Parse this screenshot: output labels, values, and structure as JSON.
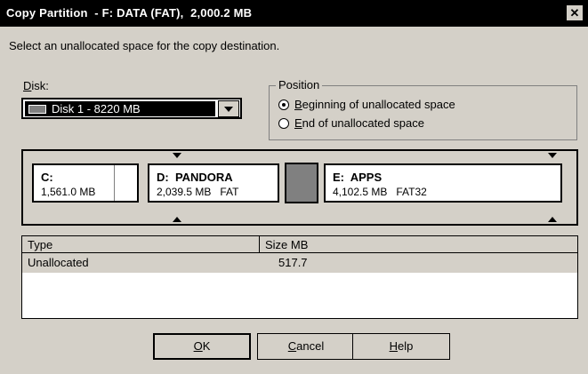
{
  "window": {
    "title": "Copy Partition  - F: DATA (FAT),  2,000.2 MB",
    "close_glyph": "✕"
  },
  "instruction": "Select an unallocated space for the copy destination.",
  "disk": {
    "label_prefix": "D",
    "label_rest": "isk:",
    "selected_value": "Disk 1 - 8220 MB",
    "icon": "hard-disk-icon"
  },
  "position": {
    "group_label": "Position",
    "options": [
      {
        "accel": "B",
        "rest": "eginning of unallocated space",
        "selected": true
      },
      {
        "accel": "E",
        "rest": "nd of unallocated space",
        "selected": false
      }
    ]
  },
  "partitions": [
    {
      "name": "C:",
      "size": "1,561.0 MB",
      "fs": ""
    },
    {
      "name": "D:  PANDORA",
      "size": "2,039.5 MB",
      "fs": "FAT"
    },
    {
      "name": "",
      "size": "",
      "fs": "",
      "unallocated": true
    },
    {
      "name": "E:  APPS",
      "size": "4,102.5 MB",
      "fs": "FAT32"
    }
  ],
  "table": {
    "columns": [
      "Type",
      "Size MB"
    ],
    "rows": [
      {
        "type": "Unallocated",
        "size": "517.7"
      }
    ]
  },
  "buttons": {
    "ok": {
      "accel": "O",
      "rest": "K"
    },
    "cancel": {
      "accel": "C",
      "rest": "ancel"
    },
    "help": {
      "accel": "H",
      "rest": "elp"
    }
  },
  "colors": {
    "title_bg": "#000000",
    "dialog_bg": "#d4d0c8",
    "unallocated_block": "#808080"
  }
}
